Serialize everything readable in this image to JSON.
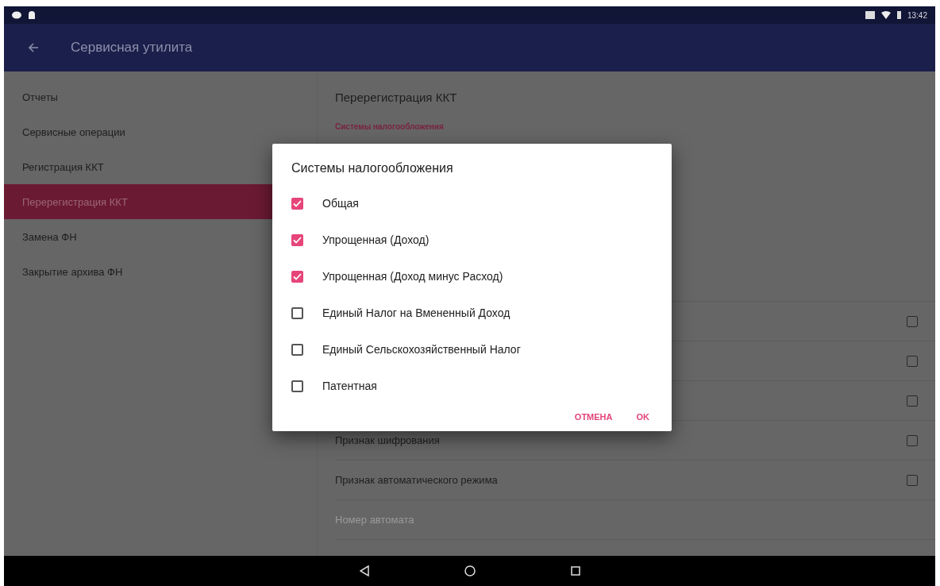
{
  "status_bar": {
    "time": "13:42"
  },
  "app_bar": {
    "title": "Сервисная утилита"
  },
  "sidebar": {
    "items": [
      {
        "label": "Отчеты",
        "selected": false
      },
      {
        "label": "Сервисные операции",
        "selected": false
      },
      {
        "label": "Регистрация ККТ",
        "selected": false
      },
      {
        "label": "Перерегистрация ККТ",
        "selected": true
      },
      {
        "label": "Замена ФН",
        "selected": false
      },
      {
        "label": "Закрытие архива ФН",
        "selected": false
      }
    ]
  },
  "detail": {
    "title": "Перерегистрация ККТ",
    "section_label": "Системы налогообложения",
    "rows": [
      {
        "checked": false
      },
      {
        "checked": false
      },
      {
        "checked": false
      },
      {
        "label": "Признак шифрования",
        "checked": false
      },
      {
        "label": "Признак автоматического режима",
        "checked": false
      }
    ],
    "disabled_field": {
      "label": "Номер автомата",
      "disabled": true
    }
  },
  "dialog": {
    "title": "Системы налогообложения",
    "options": [
      {
        "label": "Общая",
        "checked": true
      },
      {
        "label": "Упрощенная (Доход)",
        "checked": true
      },
      {
        "label": "Упрощенная (Доход минус Расход)",
        "checked": true
      },
      {
        "label": "Единый Налог на Вмененный Доход",
        "checked": false
      },
      {
        "label": "Единый Сельскохозяйственный Налог",
        "checked": false
      },
      {
        "label": "Патентная",
        "checked": false
      }
    ],
    "buttons": [
      "ОТМЕНА",
      "OK"
    ]
  }
}
